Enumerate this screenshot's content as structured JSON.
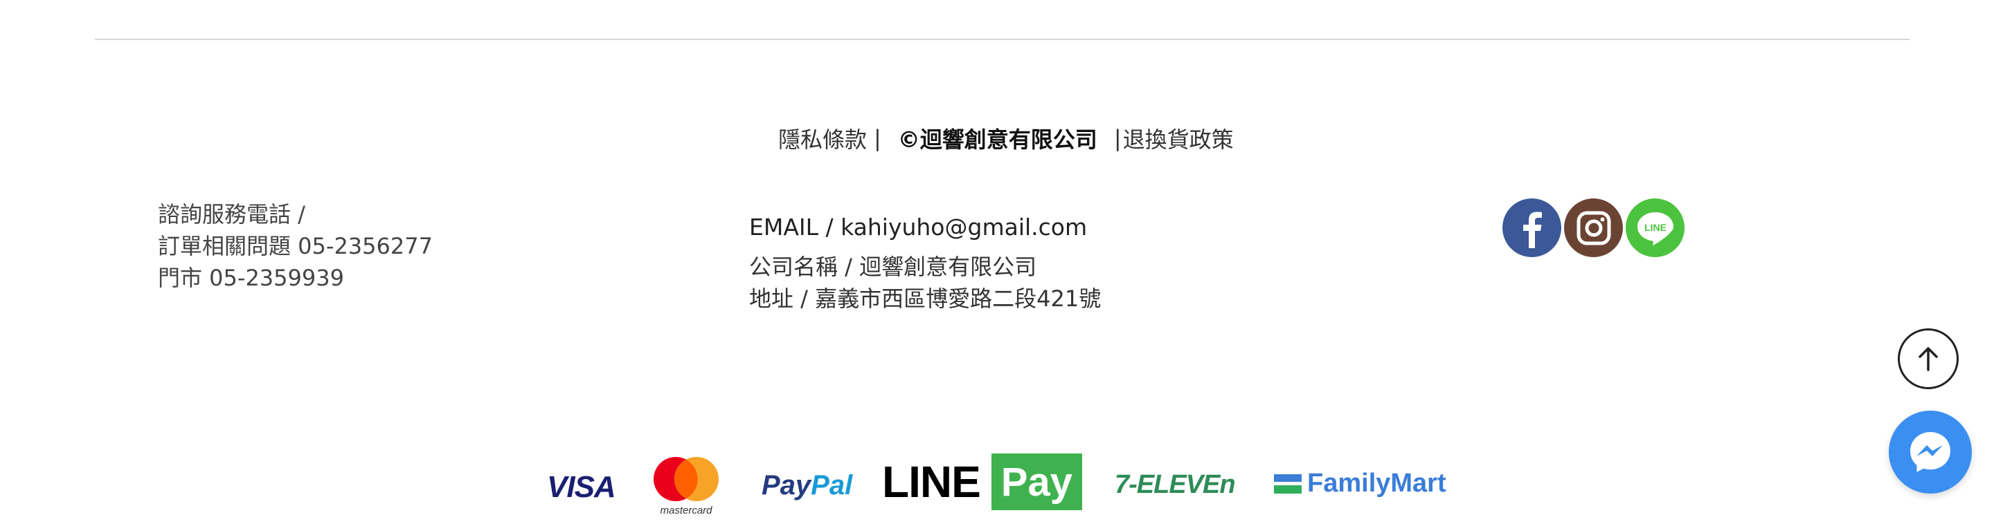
{
  "footer": {
    "policy_bar": {
      "privacy_label": "隱私條款",
      "separator_1": "|",
      "copyright": "©迴響創意有限公司",
      "separator_2": "|",
      "returns_label": "退換貨政策"
    },
    "contact_left": {
      "line1": "諮詢服務電話 /",
      "line2": "訂單相關問題  05-2356277",
      "line3": "門市  05-2359939"
    },
    "contact_mid": {
      "email": "EMAIL / kahiyuho@gmail.com",
      "company": "公司名稱 / 迴響創意有限公司",
      "address": "地址 / 嘉義市西區博愛路二段421號"
    },
    "social": [
      {
        "name": "facebook",
        "icon": "facebook-icon",
        "color": "#3b5998"
      },
      {
        "name": "instagram",
        "icon": "instagram-icon",
        "color": "#6b4333"
      },
      {
        "name": "line",
        "icon": "line-icon",
        "color": "#4cc33e",
        "text": "LINE"
      }
    ],
    "payments": {
      "visa": "VISA",
      "mastercard": "mastercard",
      "paypal_1": "Pay",
      "paypal_2": "Pal",
      "linepay_line": "LINE",
      "linepay_pay": "Pay",
      "seven_eleven": "7-ELEVEn",
      "familymart": "FamilyMart"
    }
  },
  "widgets": {
    "back_to_top_icon": "arrow-up-icon",
    "messenger_icon": "messenger-icon"
  },
  "colors": {
    "messenger": "#3b8ff2",
    "linepay_green": "#3fb24f",
    "divider": "#d6d6d6"
  }
}
